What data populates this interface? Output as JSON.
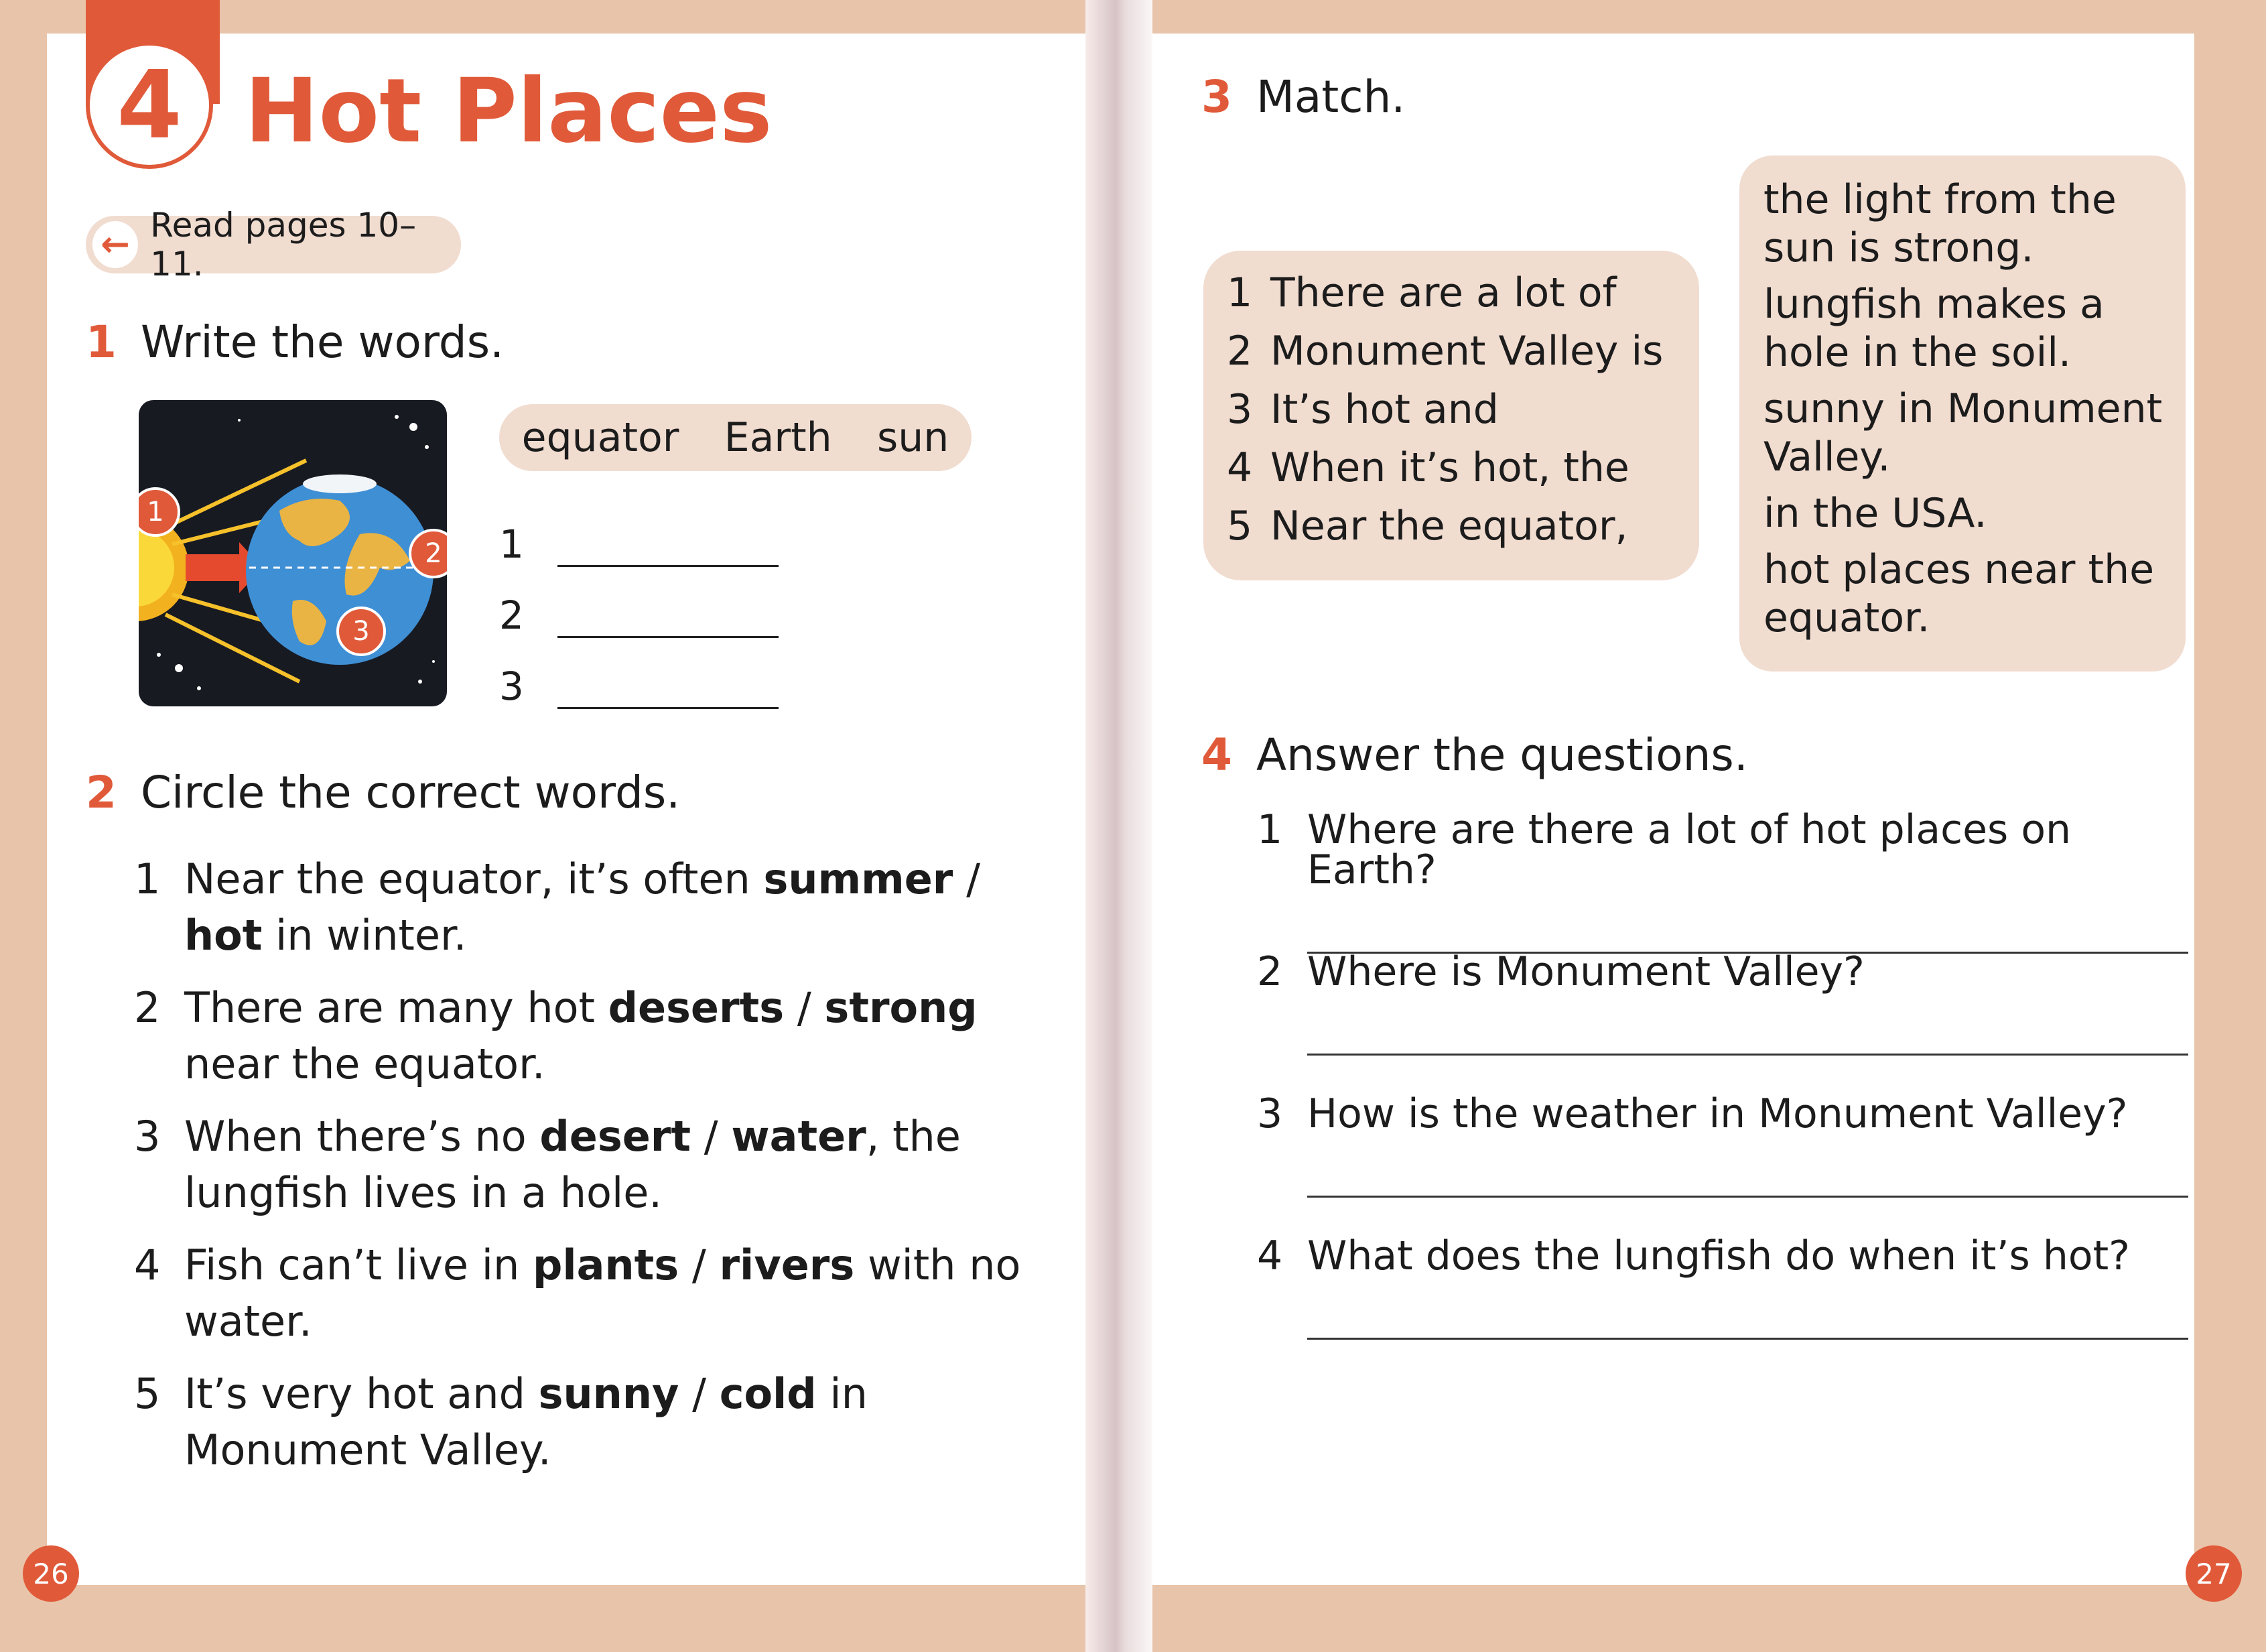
{
  "colors": {
    "accent": "#e05a3a",
    "pill": "#f1dcd0",
    "background": "#e8c4aa"
  },
  "unit": {
    "number": "4",
    "title": "Hot Places"
  },
  "read_pages": {
    "icon": "arrow-left-icon",
    "text": "Read pages 10–11."
  },
  "ex1": {
    "number": "1",
    "title": "Write the words.",
    "word_box": [
      "equator",
      "Earth",
      "sun"
    ],
    "picture_labels": [
      "1",
      "2",
      "3"
    ],
    "blanks": [
      "1",
      "2",
      "3"
    ]
  },
  "ex2": {
    "number": "2",
    "title": "Circle the correct words.",
    "items": [
      {
        "n": "1",
        "before": "Near the equator, it’s often ",
        "opt1": "summer",
        "sep": " / ",
        "opt2": "hot",
        "after": " in winter."
      },
      {
        "n": "2",
        "before": "There are many hot ",
        "opt1": "deserts",
        "sep": " / ",
        "opt2": "strong",
        "after": " near the equator."
      },
      {
        "n": "3",
        "before": "When there’s no ",
        "opt1": "desert",
        "sep": " / ",
        "opt2": "water",
        "after": ", the lungfish lives in a hole."
      },
      {
        "n": "4",
        "before": "Fish can’t live in ",
        "opt1": "plants",
        "sep": " / ",
        "opt2": "rivers",
        "after": " with no water."
      },
      {
        "n": "5",
        "before": "It’s very hot and ",
        "opt1": "sunny",
        "sep": " / ",
        "opt2": "cold",
        "after": " in Monument Valley."
      }
    ]
  },
  "ex3": {
    "number": "3",
    "title": "Match.",
    "left": [
      {
        "n": "1",
        "text": "There are a lot of"
      },
      {
        "n": "2",
        "text": "Monument Valley is"
      },
      {
        "n": "3",
        "text": "It’s hot and"
      },
      {
        "n": "4",
        "text": "When it’s hot, the"
      },
      {
        "n": "5",
        "text": "Near the equator,"
      }
    ],
    "right": [
      "the light from the sun is strong.",
      "lungfish makes a hole in the soil.",
      "sunny in Monument Valley.",
      "in the USA.",
      "hot places near the equator."
    ]
  },
  "ex4": {
    "number": "4",
    "title": "Answer the questions.",
    "questions": [
      {
        "n": "1",
        "text": "Where are there a lot of hot places on Earth?"
      },
      {
        "n": "2",
        "text": "Where is Monument Valley?"
      },
      {
        "n": "3",
        "text": "How is the weather in Monument Valley?"
      },
      {
        "n": "4",
        "text": "What does the lungfish do when it’s hot?"
      }
    ]
  },
  "page_numbers": {
    "left": "26",
    "right": "27"
  }
}
